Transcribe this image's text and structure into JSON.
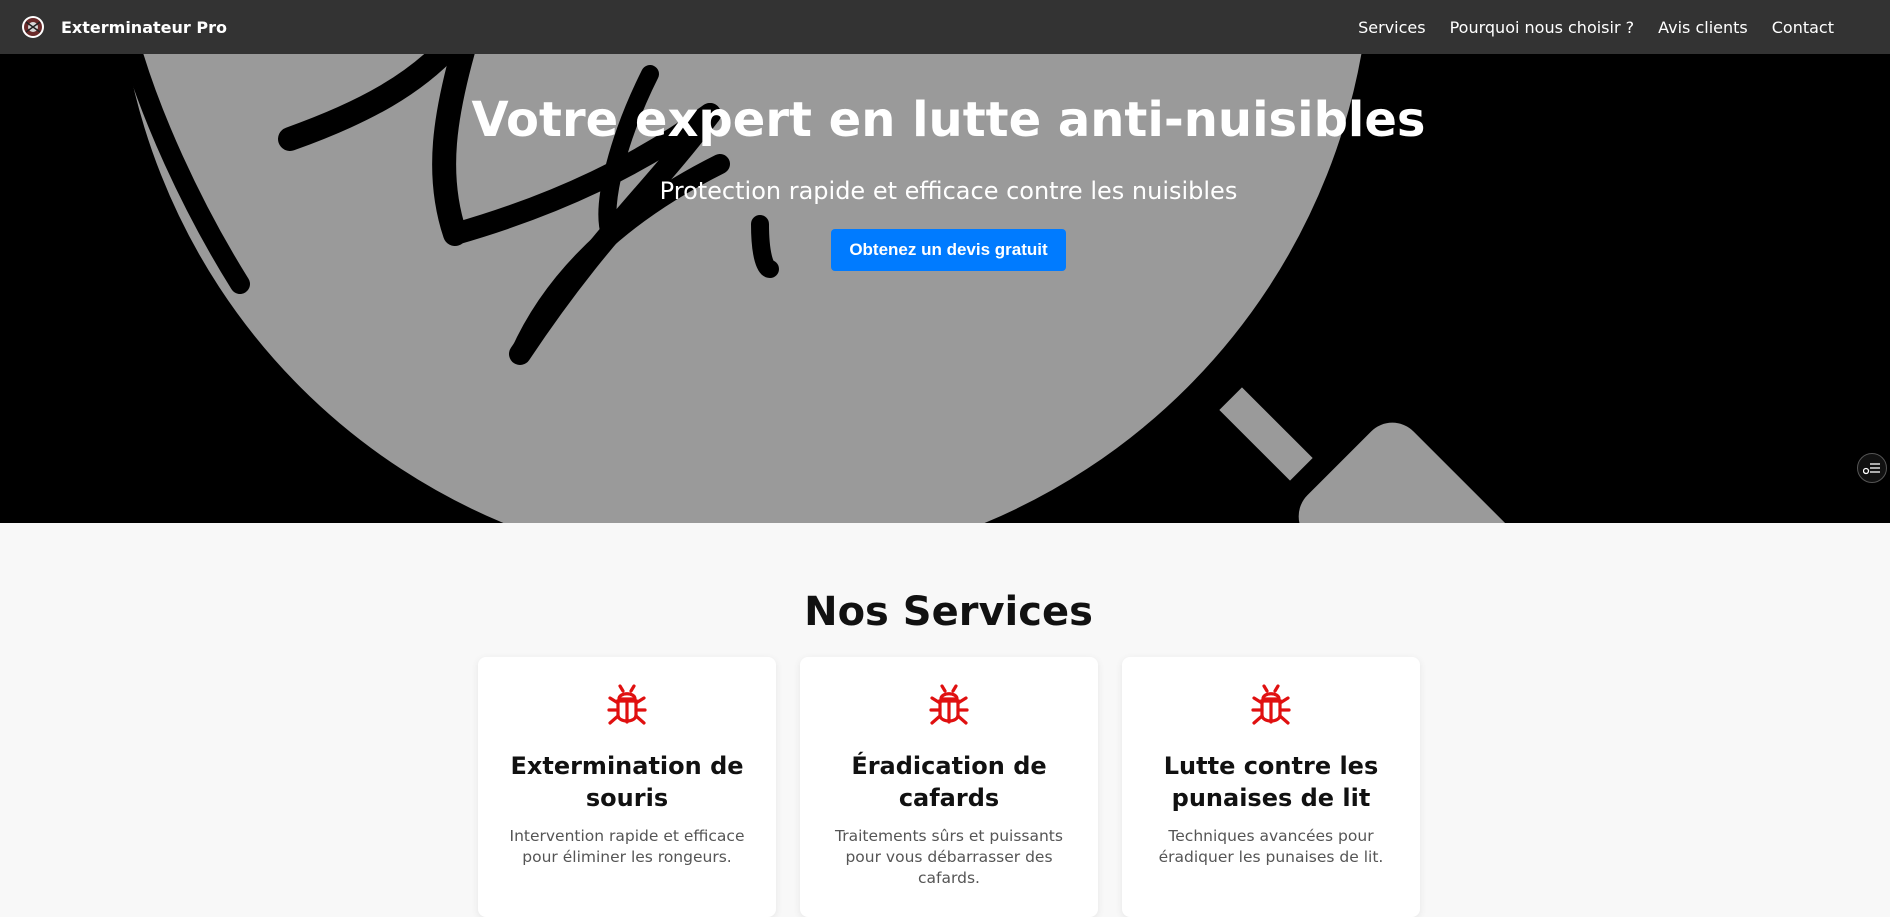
{
  "navbar": {
    "brand": "Exterminateur Pro",
    "links": [
      "Services",
      "Pourquoi nous choisir ?",
      "Avis clients",
      "Contact"
    ]
  },
  "hero": {
    "title": "Votre expert en lutte anti-nuisibles",
    "subtitle": "Protection rapide et efficace contre les nuisibles",
    "cta": "Obtenez un devis gratuit"
  },
  "services": {
    "title": "Nos Services",
    "cards": [
      {
        "icon": "bug-icon",
        "title": "Extermination de souris",
        "desc": "Intervention rapide et efficace pour éliminer les rongeurs."
      },
      {
        "icon": "bug-icon",
        "title": "Éradication de cafards",
        "desc": "Traitements sûrs et puissants pour vous débarrasser des cafards."
      },
      {
        "icon": "bug-icon",
        "title": "Lutte contre les punaises de lit",
        "desc": "Techniques avancées pour éradiquer les punaises de lit."
      }
    ]
  },
  "colors": {
    "navbar": "#333333",
    "accent": "#007bff",
    "icon": "#e01010",
    "hero_gray": "#999999"
  },
  "icons": [
    "logo-icon",
    "bug-icon",
    "settings-widget-icon"
  ]
}
